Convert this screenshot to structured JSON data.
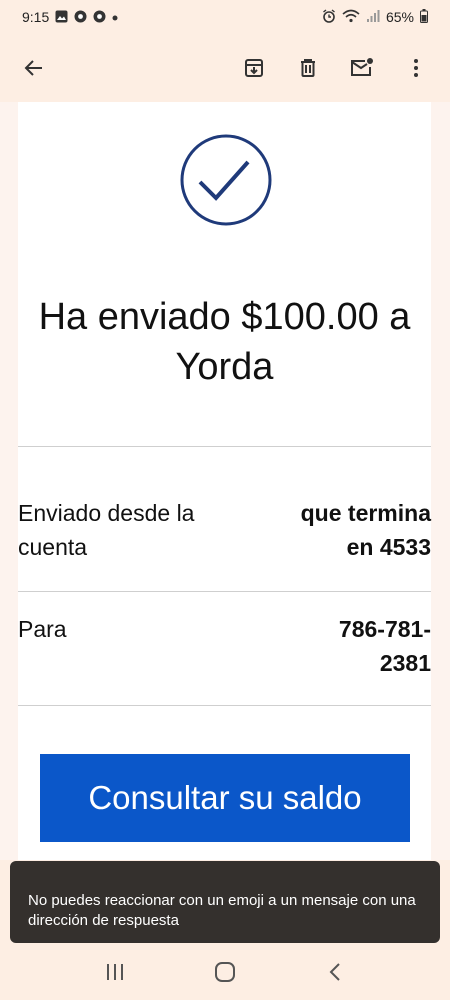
{
  "status_bar": {
    "time": "9:15",
    "battery": "65%",
    "icons_left": [
      "image-icon",
      "chrome-icon",
      "chrome-icon",
      "dot-icon"
    ],
    "icons_right": [
      "alarm-icon",
      "wifi-icon",
      "signal-icon",
      "battery-icon"
    ]
  },
  "toolbar": {
    "icons": [
      "back-arrow-icon",
      "archive-icon",
      "trash-icon",
      "mark-unread-icon",
      "more-vert-icon"
    ]
  },
  "email": {
    "headline": "Ha enviado $100.00 a Yorda",
    "rows": [
      {
        "label": "Enviado desde la cuenta",
        "value": "que termina en 4533"
      },
      {
        "label": "Para",
        "value": "786-781-2381"
      }
    ],
    "cta_label": "Consultar su saldo"
  },
  "snackbar": {
    "message": "No puedes reaccionar con un emoji a un mensaje con una dirección de respuesta"
  },
  "colors": {
    "accent": "#0b57c9",
    "check": "#1f3a7a",
    "app_bar_bg": "#fdeee3",
    "snackbar_bg": "#34302d"
  }
}
